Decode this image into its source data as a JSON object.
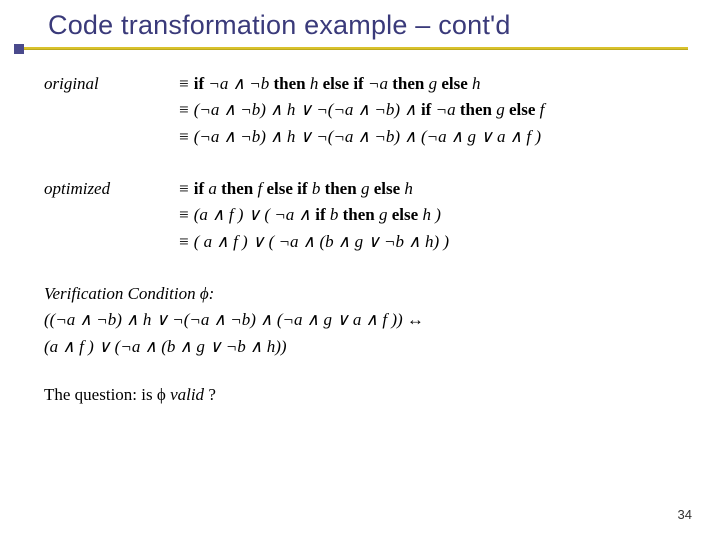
{
  "title": "Code transformation example – cont'd",
  "rows": {
    "original": {
      "label": "original",
      "line1_pre": "≡ ",
      "line1_kw_if": "if",
      "line1_seg1": " ¬a ∧ ¬b ",
      "line1_kw_then": "then",
      "line1_seg2": " h ",
      "line1_kw_else": "else",
      "line1_seg3": "  ",
      "line1_kw_if2": "if",
      "line1_seg4": " ¬a ",
      "line1_kw_then2": "then",
      "line1_seg5": " g ",
      "line1_kw_else2": "else",
      "line1_seg6": " h",
      "line2_pre": "≡ (¬a ∧ ¬b)  ∧ h ∨  ¬(¬a ∧ ¬b)  ∧ ",
      "line2_kw_if": "if",
      "line2_seg1": " ¬a ",
      "line2_kw_then": "then",
      "line2_seg2": " g ",
      "line2_kw_else": "else",
      "line2_seg3": " f",
      "line3": "≡ (¬a ∧ ¬b)  ∧ h  ∨ ¬(¬a ∧ ¬b)  ∧ (¬a ∧ g ∨ a ∧  f )"
    },
    "optimized": {
      "label": "optimized",
      "line1_pre": "≡  ",
      "line1_kw_if": "if",
      "line1_seg1": " a ",
      "line1_kw_then": "then",
      "line1_seg2": " f  ",
      "line1_kw_else": "else",
      "line1_seg3": " ",
      "line1_kw_if2": "if",
      "line1_seg4": " b ",
      "line1_kw_then2": "then",
      "line1_seg5": " g ",
      "line1_kw_else2": "else",
      "line1_seg6": " h",
      "line2_pre": "≡ (a ∧  f ) ∨ ( ¬a ∧ ",
      "line2_kw_if": "if",
      "line2_seg1": " b ",
      "line2_kw_then": "then",
      "line2_seg2": " g ",
      "line2_kw_else": "else",
      "line2_seg3": " h )",
      "line3": "≡ ( a ∧  f ) ∨ ( ¬a ∧ (b ∧ g ∨ ¬b ∧ h) )"
    }
  },
  "vc": {
    "heading_pre": "Verification Condition",
    "heading_post": " ϕ:",
    "line1": "((¬a ∧ ¬b)  ∧ h  ∨ ¬(¬a ∧ ¬b)  ∧ (¬a ∧ g ∨ a ∧  f )) ↔",
    "line2": "(a ∧  f ) ∨ (¬a ∧ (b ∧ g ∨ ¬b ∧ h))"
  },
  "question": {
    "pre": "The question: is ϕ ",
    "valid": "valid",
    "post": " ?"
  },
  "page": "34"
}
